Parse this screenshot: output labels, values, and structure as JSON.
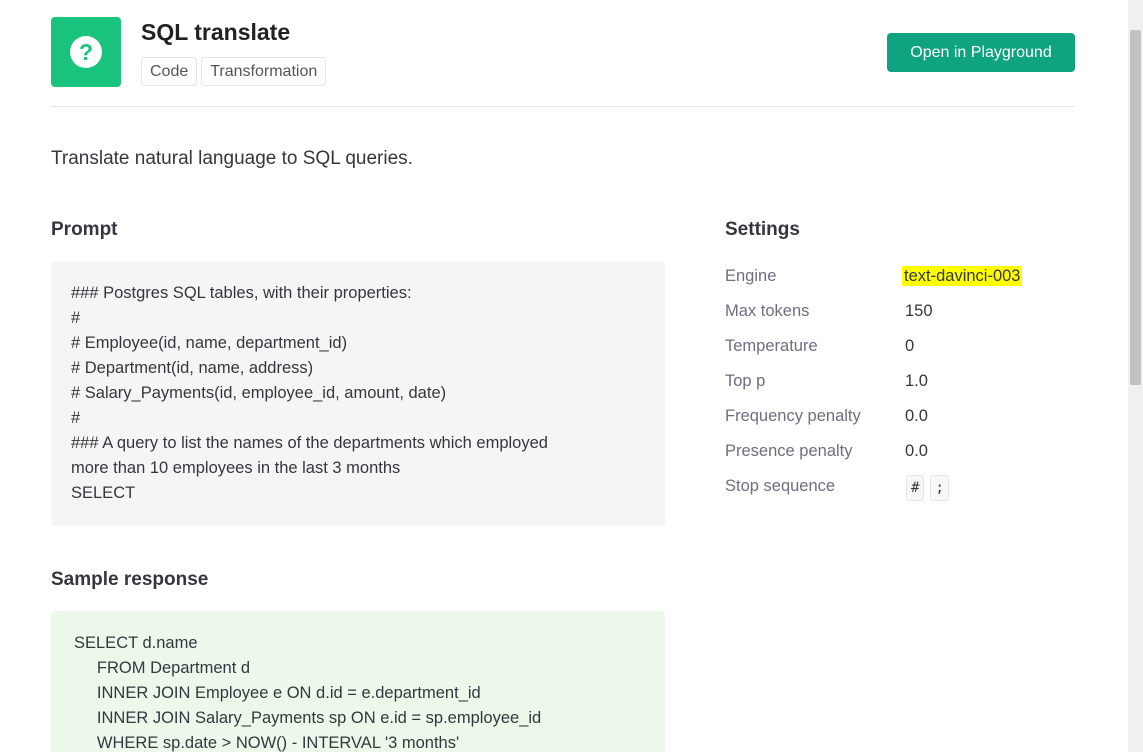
{
  "header": {
    "app_icon": "question-mark-icon",
    "icon_glyph": "?",
    "title": "SQL translate",
    "tags": [
      "Code",
      "Transformation"
    ],
    "open_button_label": "Open in Playground",
    "accent_color": "#10a37f",
    "icon_color": "#19c37d"
  },
  "description": "Translate natural language to SQL queries.",
  "prompt": {
    "title": "Prompt",
    "lines": [
      "### Postgres SQL tables, with their properties:",
      "#",
      "# Employee(id, name, department_id)",
      "# Department(id, name, address)",
      "# Salary_Payments(id, employee_id, amount, date)",
      "#",
      "### A query to list the names of the departments which employed",
      "more than 10 employees in the last 3 months",
      "SELECT"
    ]
  },
  "sample": {
    "title": "Sample response",
    "lines": [
      "SELECT d.name",
      "     FROM Department d",
      "     INNER JOIN Employee e ON d.id = e.department_id",
      "     INNER JOIN Salary_Payments sp ON e.id = sp.employee_id",
      "     WHERE sp.date > NOW() - INTERVAL '3 months'"
    ],
    "background_color": "#ebf8ea"
  },
  "settings": {
    "title": "Settings",
    "engine_label": "Engine",
    "engine_value": "text-davinci-003",
    "max_tokens_label": "Max tokens",
    "max_tokens_value": "150",
    "temperature_label": "Temperature",
    "temperature_value": "0",
    "top_p_label": "Top p",
    "top_p_value": "1.0",
    "frequency_penalty_label": "Frequency penalty",
    "frequency_penalty_value": "0.0",
    "presence_penalty_label": "Presence penalty",
    "presence_penalty_value": "0.0",
    "stop_sequence_label": "Stop sequence",
    "stop_sequence_values": [
      "#",
      ";"
    ],
    "highlight_color": "#ffff00"
  }
}
